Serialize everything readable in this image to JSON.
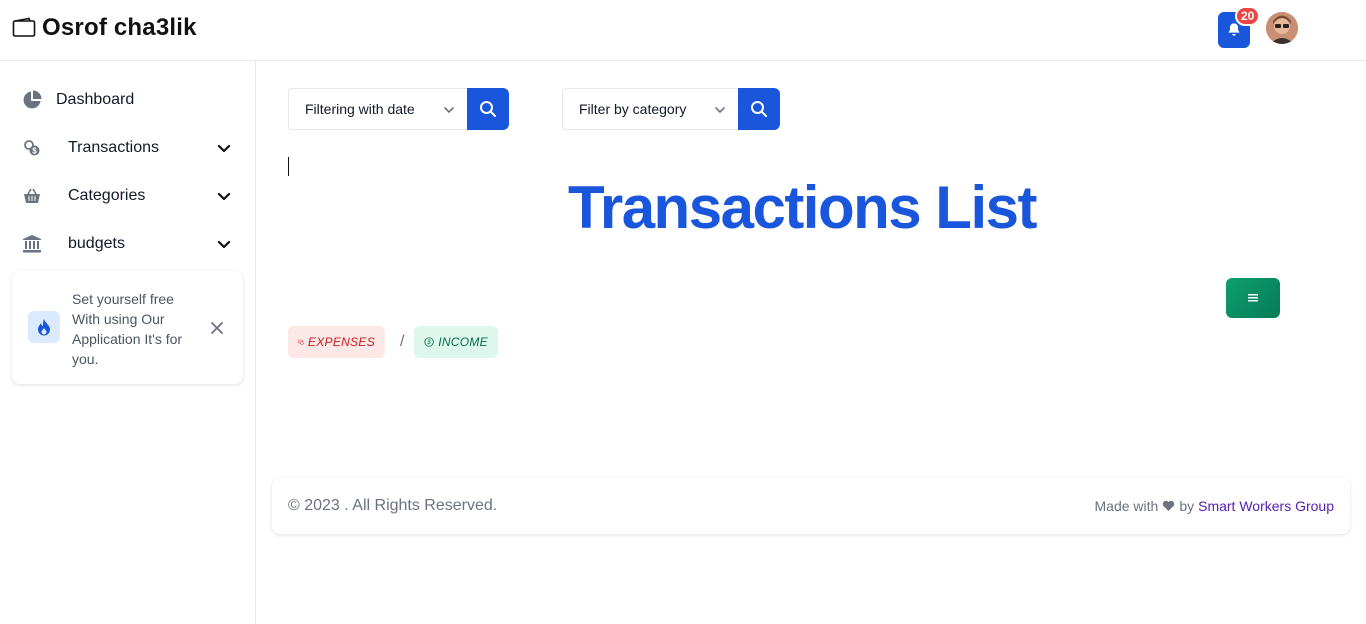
{
  "header": {
    "brand_title": "Osrof cha3lik",
    "notifications_count": "20",
    "brand_icon": "wallet-icon",
    "accent_color": "#1a56db"
  },
  "sidebar": {
    "items": [
      {
        "label": "Dashboard",
        "icon": "pie-chart-icon"
      },
      {
        "label": "Transactions",
        "icon": "coins-icon"
      },
      {
        "label": "Categories",
        "icon": "basket-icon"
      },
      {
        "label": "budgets",
        "icon": "bank-icon"
      }
    ],
    "promo": {
      "text": "Set yourself free With using Our Application It's for you.",
      "icon": "fire-icon"
    }
  },
  "filters": {
    "date_label": "Filtering with date",
    "category_label": "Filter by category"
  },
  "main": {
    "title": "Transactions List",
    "badges": {
      "expenses": "EXPENSES",
      "separator": "/",
      "income": "INCOME"
    }
  },
  "footer": {
    "copyright": "© 2023 . All Rights Reserved.",
    "made_with_prefix": "Made with",
    "made_with_by": "by",
    "made_with_link": "Smart Workers Group"
  }
}
